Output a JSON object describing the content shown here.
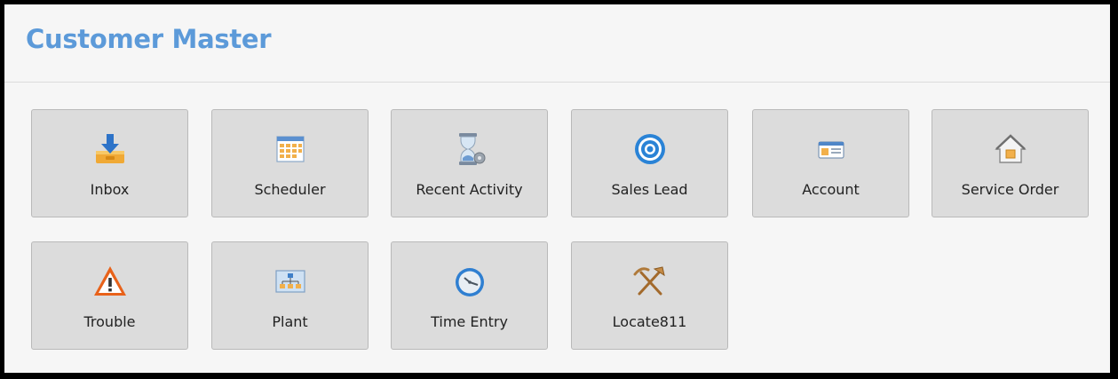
{
  "header": {
    "title": "Customer Master"
  },
  "tiles": [
    {
      "label": "Inbox",
      "icon": "inbox-icon"
    },
    {
      "label": "Scheduler",
      "icon": "scheduler-icon"
    },
    {
      "label": "Recent Activity",
      "icon": "hourglass-icon"
    },
    {
      "label": "Sales Lead",
      "icon": "target-icon"
    },
    {
      "label": "Account",
      "icon": "account-card-icon"
    },
    {
      "label": "Service Order",
      "icon": "house-icon"
    },
    {
      "label": "Trouble",
      "icon": "warning-icon"
    },
    {
      "label": "Plant",
      "icon": "plant-network-icon"
    },
    {
      "label": "Time Entry",
      "icon": "clock-icon"
    },
    {
      "label": "Locate811",
      "icon": "pick-shovel-icon"
    }
  ],
  "colors": {
    "title": "#5c9ad9",
    "tile_background": "#dcdcdc",
    "tile_border": "#b9b9b9",
    "page_background": "#f6f6f6"
  }
}
